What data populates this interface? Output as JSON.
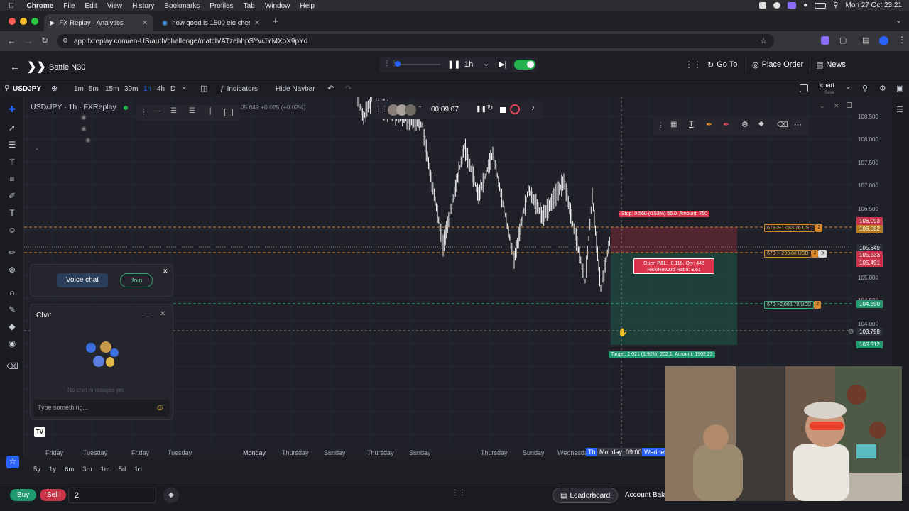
{
  "menubar": {
    "items": [
      "Chrome",
      "File",
      "Edit",
      "View",
      "History",
      "Bookmarks",
      "Profiles",
      "Tab",
      "Window",
      "Help"
    ],
    "datetime": "Mon 27 Oct  23:21"
  },
  "browser": {
    "tabs": [
      {
        "title": "FX Replay - Analytics",
        "active": true
      },
      {
        "title": "how good is 1500 elo chess",
        "active": false
      }
    ],
    "url": "app.fxreplay.com/en-US/auth/challenge/match/ATzehhpSYv/JYMXoX9pYd"
  },
  "app": {
    "title": "Battle N30",
    "replay_timeframe": "1h",
    "goto_label": "Go To",
    "place_order_label": "Place Order",
    "news_label": "News"
  },
  "toolbar": {
    "symbol": "USDJPY",
    "timeframes": [
      "1m",
      "5m",
      "15m",
      "30m",
      "1h",
      "4h",
      "D"
    ],
    "active_timeframe": "1h",
    "indicators_label": "Indicators",
    "hide_navbar_label": "Hide Navbar",
    "layout_label": "chart",
    "layout_sub": "Save"
  },
  "chart": {
    "legend": "USD/JPY · 1h · FXReplay",
    "ohlc_fragment": "105.649  +0.025 (+0.02%)",
    "timer": "00:09:07",
    "stop_label": "Stop: 0.560 (0.53%) 56.0, Amount: 750",
    "pnl_label_1": "Open P&L: -0.116, Qty: 446",
    "pnl_label_2": "Risk/Reward Ratio: 3.61",
    "target_label": "Target: 2.021 (1.92%) 202.1, Amount: 1902.23",
    "order_tags": [
      {
        "text": "673->-1,083.76 USD",
        "qty": "2"
      },
      {
        "text": "673->-299.88 USD",
        "qty": "2"
      },
      {
        "text": "673->2,089.70 USD",
        "qty": "2"
      }
    ],
    "price_ticks": [
      "108.500",
      "108.000",
      "107.500",
      "107.000",
      "106.500",
      "106.000",
      "105.500",
      "105.000",
      "104.500",
      "104.000",
      "103.500"
    ],
    "price_badges": [
      {
        "text": "106.093",
        "color": "#c9364a"
      },
      {
        "text": "106.082",
        "color": "#b37a1f"
      },
      {
        "text": "105.649",
        "color": "#2b2d36"
      },
      {
        "text": "105.533",
        "color": "#c9364a"
      },
      {
        "text": "105.491",
        "color": "#c9364a"
      },
      {
        "text": "104.390",
        "color": "#1f9a6e"
      },
      {
        "text": "103.798",
        "color": "#2b2d36"
      },
      {
        "text": "103.512",
        "color": "#1f9a6e"
      }
    ],
    "time_labels": [
      "Friday",
      "Tuesday",
      "Friday",
      "Tuesday",
      "Monday",
      "Thursday",
      "Sunday",
      "Thursday",
      "Sunday",
      "Thursday",
      "Sunday",
      "Wednesda",
      "Th",
      "Monday  09:00",
      "Wednes"
    ]
  },
  "ranges": [
    "5y",
    "1y",
    "6m",
    "3m",
    "1m",
    "5d",
    "1d"
  ],
  "voice": {
    "label": "Voice chat",
    "join": "Join"
  },
  "chat": {
    "title": "Chat",
    "empty": "No chat messages yet",
    "placeholder": "Type something..."
  },
  "bottom": {
    "buy_label": "Buy",
    "sell_label": "Sell",
    "qty_value": "2",
    "leaderboard_label": "Leaderboard",
    "account_label": "Account Bala"
  },
  "colors": {
    "accent": "#2962ff",
    "buy": "#1f9a6e",
    "sell": "#c9364a",
    "toggle": "#22b14c"
  }
}
